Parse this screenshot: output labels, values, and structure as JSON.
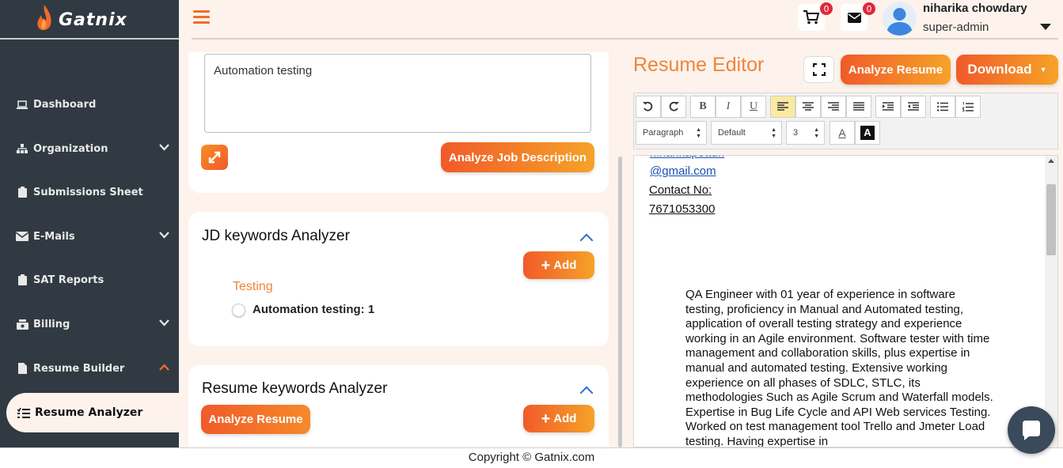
{
  "app": {
    "brand": "Gatnix"
  },
  "sidebar": {
    "items": [
      {
        "label": "Dashboard",
        "icon": "laptop-icon"
      },
      {
        "label": "Organization",
        "icon": "sitemap-icon"
      },
      {
        "label": "Submissions Sheet",
        "icon": "clipboard-icon"
      },
      {
        "label": "E-Mails",
        "icon": "mail-icon"
      },
      {
        "label": "SAT Reports",
        "icon": "clipboard-icon"
      },
      {
        "label": "Billing",
        "icon": "money-icon"
      },
      {
        "label": "Resume Builder",
        "icon": "file-icon"
      },
      {
        "label": "Resume Analyzer",
        "icon": "list-icon"
      }
    ]
  },
  "header": {
    "cart_count": "0",
    "mail_count": "0",
    "user_name": "niharika chowdary",
    "user_role": "super-admin"
  },
  "job_description": {
    "text": "Automation testing",
    "analyze_label": "Analyze Job Description"
  },
  "jd_keywords": {
    "title": "JD keywords Analyzer",
    "add_label": "Add",
    "category": "Testing",
    "item": "Automation testing: 1"
  },
  "resume_keywords": {
    "title": "Resume keywords Analyzer",
    "analyze_label": "Analyze Resume",
    "add_label": "Add"
  },
  "editor": {
    "title": "Resume Editor",
    "analyze_label": "Analyze Resume",
    "download_label": "Download",
    "toolbar": {
      "bold": "B",
      "italic": "I",
      "underline": "U",
      "block_format": "Paragraph",
      "font": "Default",
      "size": "3",
      "font_color": "A",
      "bg_color": "A"
    },
    "doc": {
      "partial_line": "niharikapotturi",
      "email": "@gmail.com",
      "contact_label": "Contact No:",
      "phone": "7671053300",
      "summary": "QA Engineer with 01 year of experience in software testing, proficiency in Manual and Automated testing, application of overall testing strategy and experience working in an Agile environment. Software tester with time management and collaboration skills, plus expertise in manual and automated testing. Extensive working experience on all phases of SDLC, STLC, its methodologies Such as Agile Scrum and Waterfall models. Expertise in Bug Life Cycle and API Web services Testing. Worked on test management tool Trello and  Jmeter Load testing. Having expertise in"
    }
  },
  "footer": {
    "copyright": "Copyright © Gatnix.com"
  }
}
